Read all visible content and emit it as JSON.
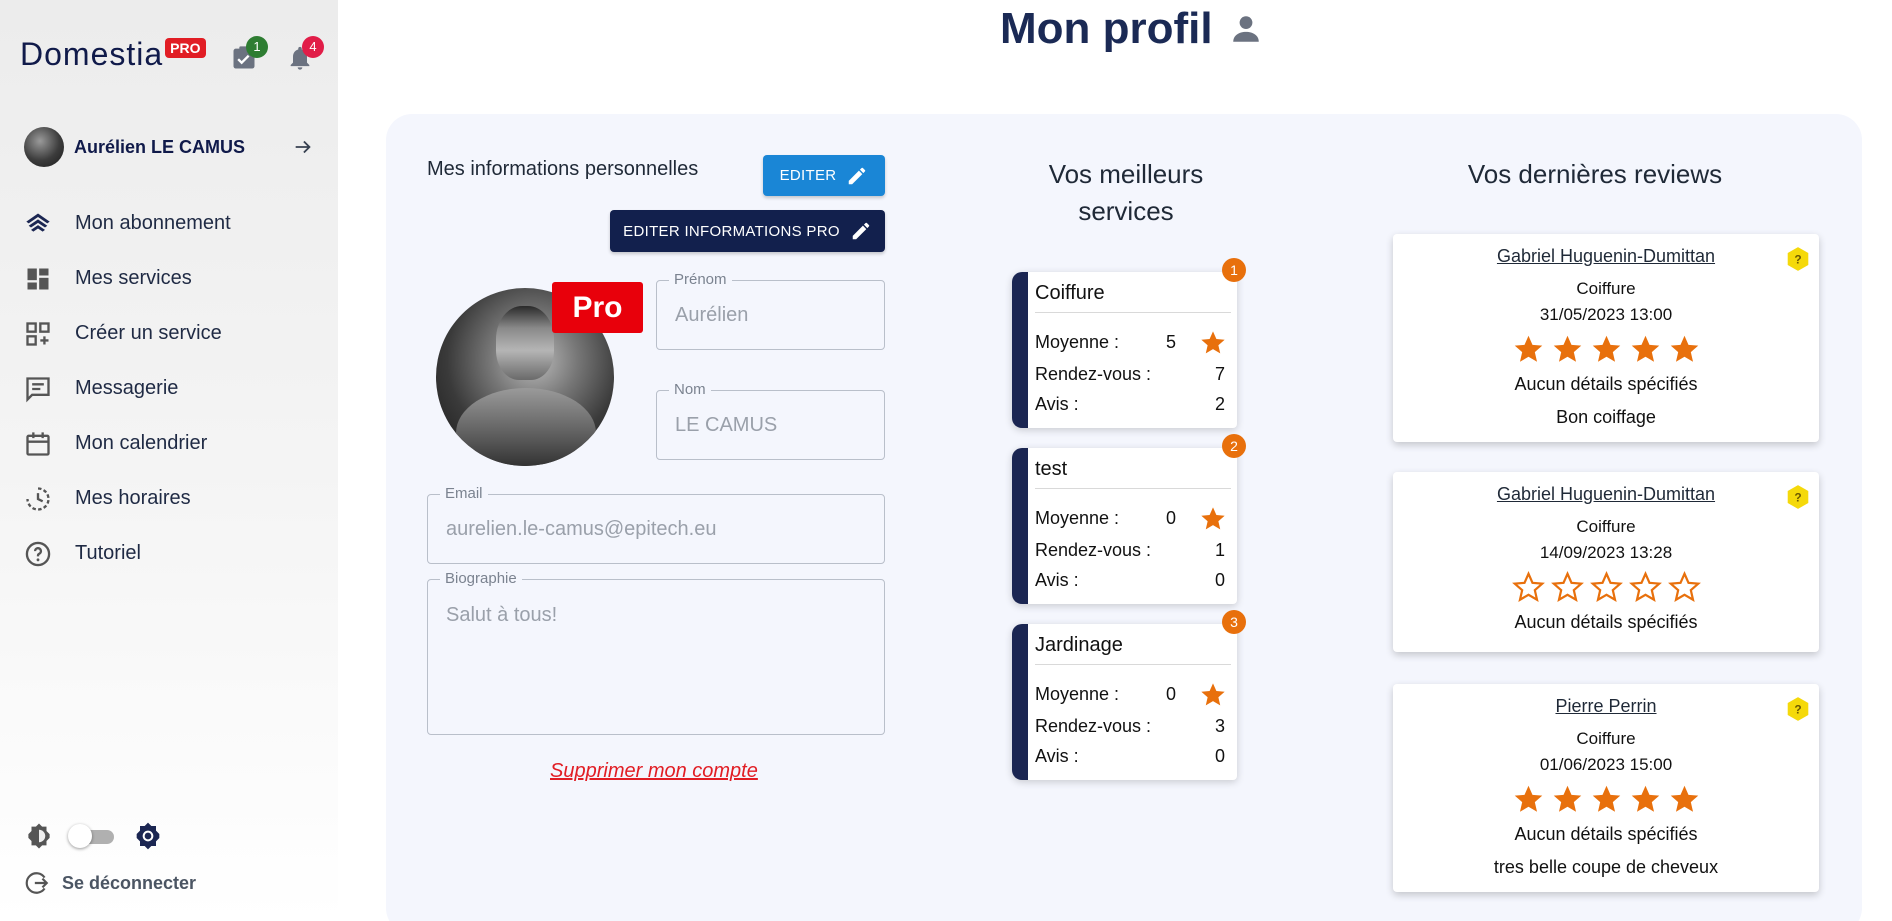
{
  "brand": {
    "name": "Domestia",
    "badge": "PRO"
  },
  "header": {
    "tasks_count": "1",
    "notifications_count": "4",
    "title": "Mon profil"
  },
  "user": {
    "name": "Aurélien LE CAMUS"
  },
  "sidebar": {
    "items": [
      {
        "label": "Mon abonnement",
        "icon": "subscription-icon"
      },
      {
        "label": "Mes services",
        "icon": "dashboard-icon"
      },
      {
        "label": "Créer un service",
        "icon": "add-service-icon"
      },
      {
        "label": "Messagerie",
        "icon": "message-icon"
      },
      {
        "label": "Mon calendrier",
        "icon": "calendar-icon"
      },
      {
        "label": "Mes horaires",
        "icon": "schedule-icon"
      },
      {
        "label": "Tutoriel",
        "icon": "help-icon"
      }
    ],
    "logout": "Se déconnecter"
  },
  "profile": {
    "section_label": "Mes informations personnelles",
    "edit_button": "EDITER",
    "edit_pro_button": "EDITER INFORMATIONS PRO",
    "pro_tag": "Pro",
    "fields": {
      "prenom": {
        "label": "Prénom",
        "value": "Aurélien"
      },
      "nom": {
        "label": "Nom",
        "value": "LE CAMUS"
      },
      "email": {
        "label": "Email",
        "value": "aurelien.le-camus@epitech.eu"
      },
      "bio": {
        "label": "Biographie",
        "value": "Salut à tous!"
      }
    },
    "delete_link": "Supprimer mon compte"
  },
  "services": {
    "title": "Vos meilleurs services",
    "labels": {
      "average": "Moyenne :",
      "appointments": "Rendez-vous :",
      "reviews": "Avis :"
    },
    "items": [
      {
        "rank": "1",
        "name": "Coiffure",
        "average": "5",
        "appointments": "7",
        "reviews": "2"
      },
      {
        "rank": "2",
        "name": "test",
        "average": "0",
        "appointments": "1",
        "reviews": "0"
      },
      {
        "rank": "3",
        "name": "Jardinage",
        "average": "0",
        "appointments": "3",
        "reviews": "0"
      }
    ]
  },
  "reviews": {
    "title": "Vos dernières reviews",
    "items": [
      {
        "author": "Gabriel Huguenin-Dumittan",
        "service": "Coiffure",
        "date": "31/05/2023 13:00",
        "rating": 5,
        "details": "Aucun détails spécifiés",
        "comment": "Bon coiffage"
      },
      {
        "author": "Gabriel Huguenin-Dumittan",
        "service": "Coiffure",
        "date": "14/09/2023 13:28",
        "rating": 0,
        "details": "Aucun détails spécifiés",
        "comment": ""
      },
      {
        "author": "Pierre Perrin",
        "service": "Coiffure",
        "date": "01/06/2023 15:00",
        "rating": 5,
        "details": "Aucun détails spécifiés",
        "comment": "tres belle coupe de cheveux"
      }
    ]
  },
  "colors": {
    "navy": "#12204d",
    "accent_blue": "#1a86d6",
    "star_orange": "#e8700c",
    "pro_red": "#e8000b"
  }
}
